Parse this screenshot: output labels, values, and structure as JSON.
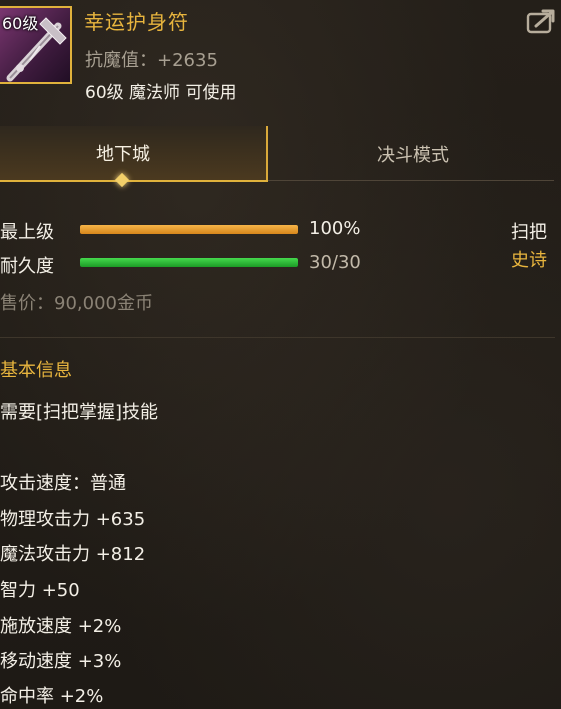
{
  "item": {
    "level_badge": "60级",
    "name": "幸运护身符",
    "magic_resist": "抗魔值：+2635",
    "usable_by": "60级 魔法师 可使用",
    "type": "扫把",
    "rarity": "史诗",
    "sell_price": "售价：90,000金币"
  },
  "tabs": [
    {
      "label": "地下城",
      "active": true
    },
    {
      "label": "决斗模式",
      "active": false
    }
  ],
  "stats": {
    "grade": {
      "label": "最上级",
      "value_text": "100%",
      "fraction": 1.0
    },
    "durability": {
      "label": "耐久度",
      "value_text": "30/30",
      "fraction": 1.0
    }
  },
  "basic_info": {
    "title": "基本信息",
    "lines": [
      "需要[扫把掌握]技能",
      "",
      "攻击速度：普通",
      "物理攻击力 +635",
      "魔法攻击力 +812",
      "智力 +50",
      "施放速度 +2%",
      "移动速度 +3%",
      "命中率 +2%"
    ]
  },
  "colors": {
    "accent_gold": "#e8b53e",
    "grade_bar": "#e9a22f",
    "durability_bar": "#2fc63a"
  },
  "icons": {
    "share": "share-export-icon",
    "item": "broom-weapon-icon"
  }
}
